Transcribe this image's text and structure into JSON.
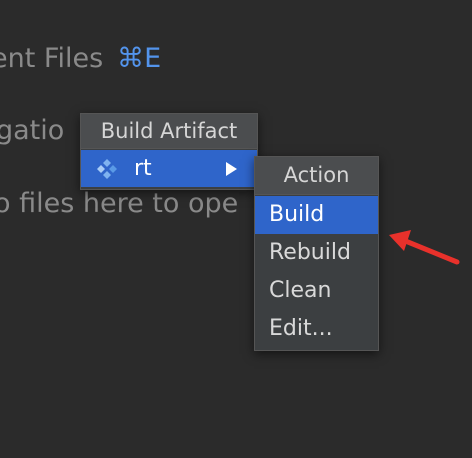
{
  "background_hints": {
    "recent_files": "ent Files",
    "recent_files_shortcut": "⌘E",
    "navigation": "gatio",
    "drop_files": "o files here to ope"
  },
  "popup_artifact": {
    "title": "Build Artifact",
    "item_label": "rt"
  },
  "popup_action": {
    "title": "Action",
    "items": [
      "Build",
      "Rebuild",
      "Clean",
      "Edit..."
    ]
  },
  "colors": {
    "background": "#2b2b2b",
    "popup": "#3c3f41",
    "selection": "#2f65ca",
    "shortcut": "#5394ec",
    "annotation": "#e8312b"
  }
}
